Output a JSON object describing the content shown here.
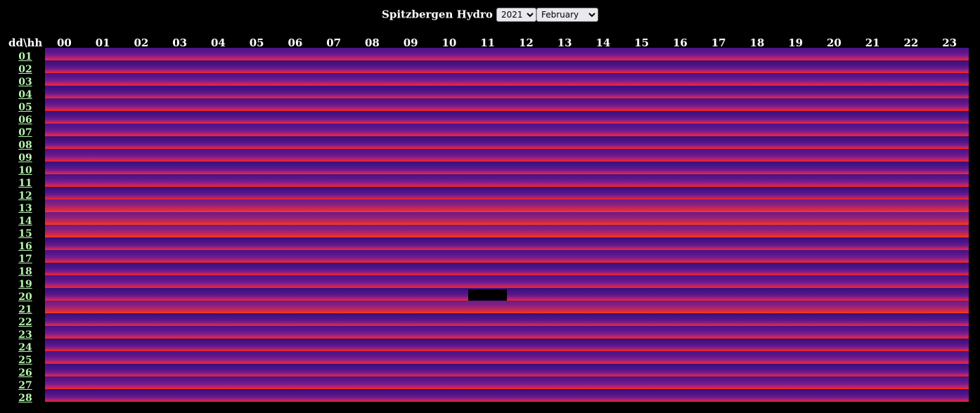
{
  "header": {
    "title": "Spitzbergen Hydro",
    "year": "2021",
    "month": "February"
  },
  "corner_label": "dd\\hh",
  "hours": [
    "00",
    "01",
    "02",
    "03",
    "04",
    "05",
    "06",
    "07",
    "08",
    "09",
    "10",
    "11",
    "12",
    "13",
    "14",
    "15",
    "16",
    "17",
    "18",
    "19",
    "20",
    "21",
    "22",
    "23"
  ],
  "days": [
    "01",
    "02",
    "03",
    "04",
    "05",
    "06",
    "07",
    "08",
    "09",
    "10",
    "11",
    "12",
    "13",
    "14",
    "15",
    "16",
    "17",
    "18",
    "19",
    "20",
    "21",
    "22",
    "23",
    "24",
    "25",
    "26",
    "27",
    "28"
  ],
  "hot_days": [
    "13",
    "14",
    "15",
    "21"
  ],
  "missing": [
    {
      "day": "20",
      "hour_start": 11,
      "hour_end": 12
    }
  ]
}
